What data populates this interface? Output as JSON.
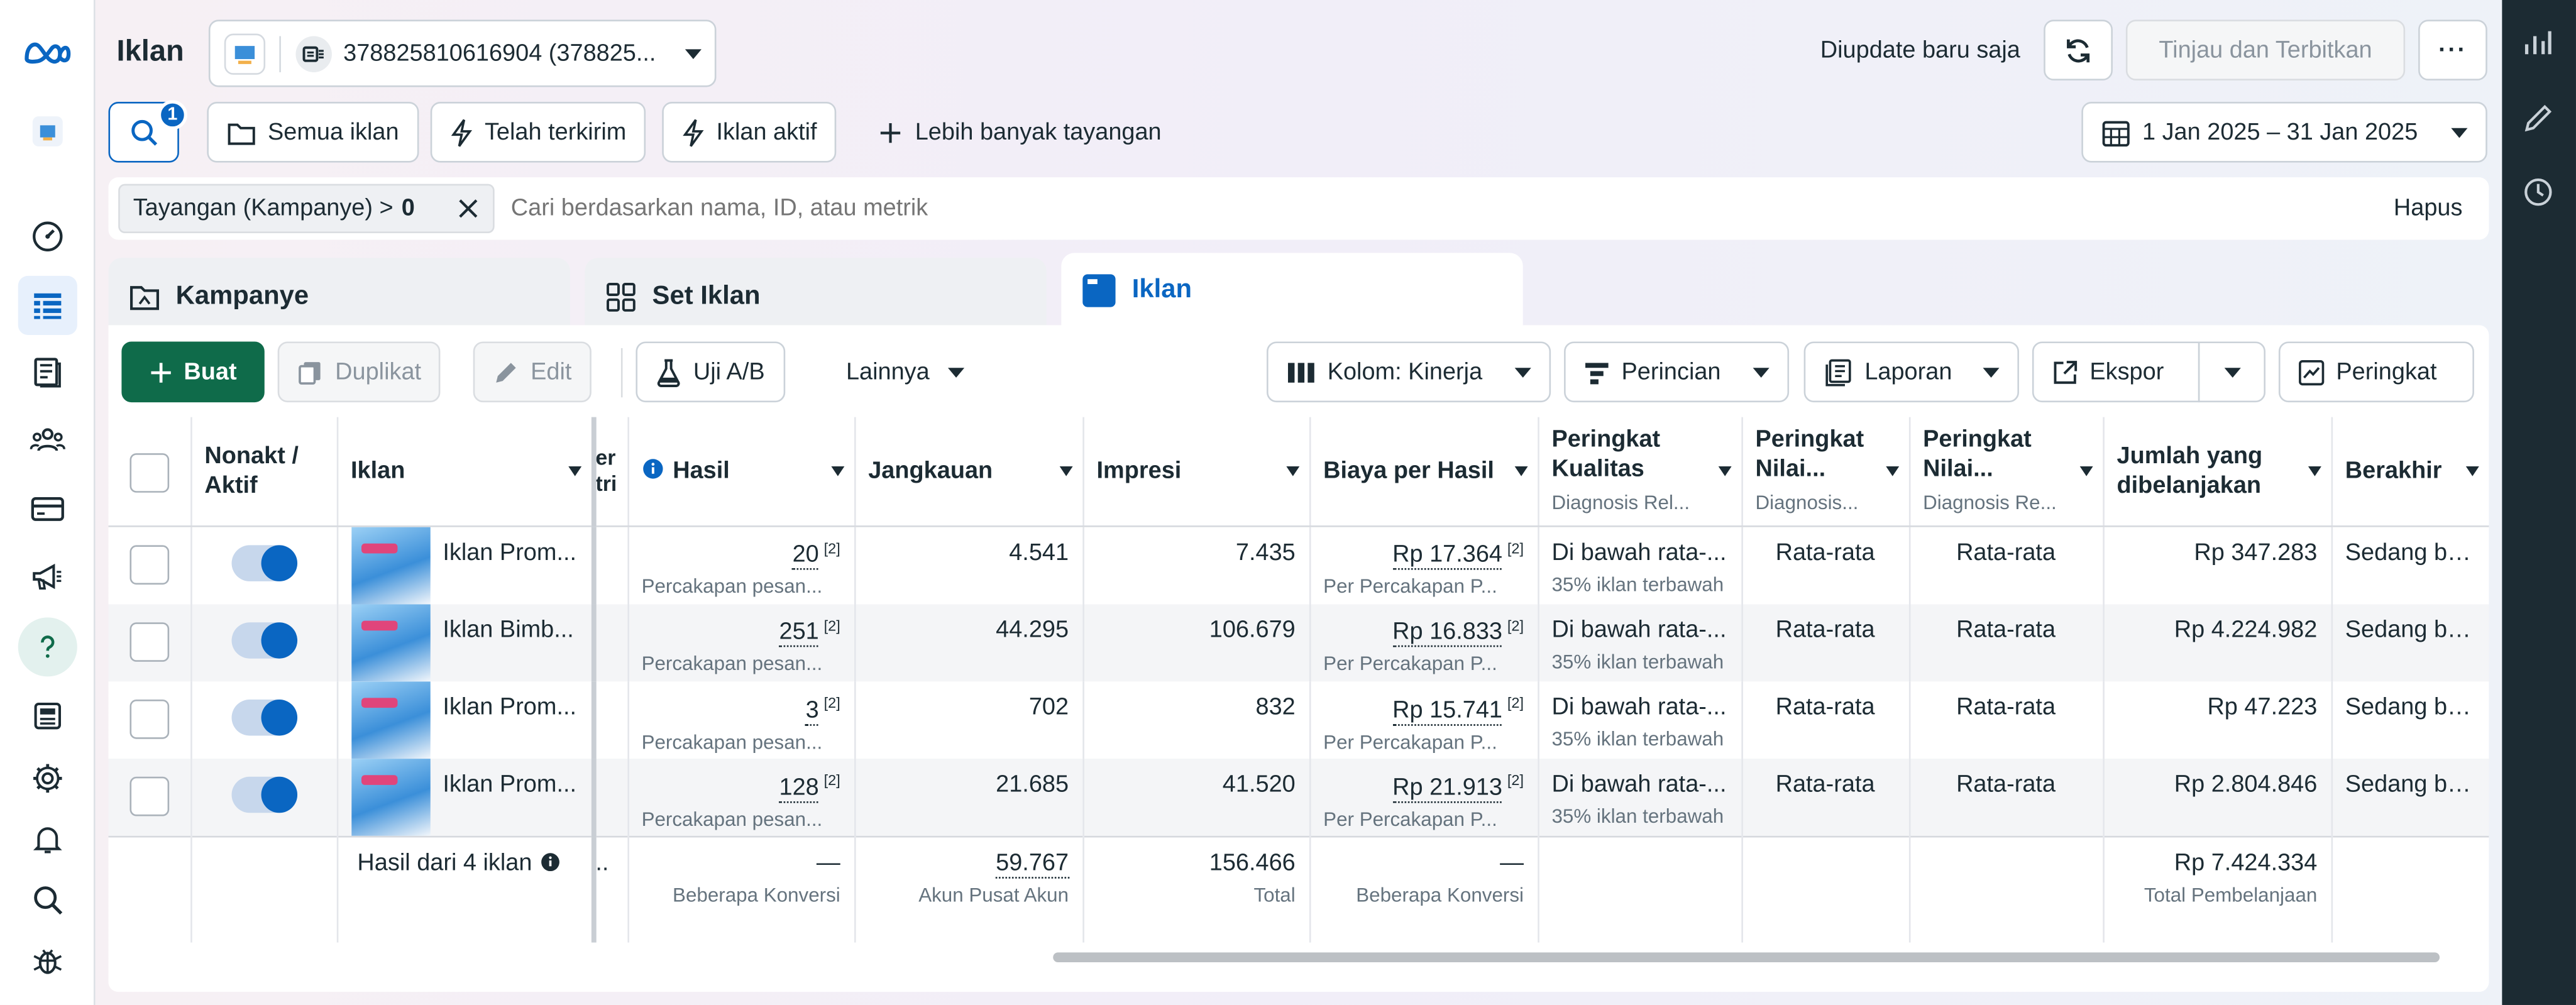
{
  "header": {
    "title": "Iklan",
    "account_name": "378825810616904 (378825...",
    "update_status": "Diupdate baru saja",
    "review_publish": "Tinjau dan Terbitkan",
    "more_label": "···"
  },
  "toolbar": {
    "search_badge": "1",
    "all_ads": "Semua iklan",
    "delivered": "Telah terkirim",
    "active_ads": "Iklan aktif",
    "more_views": "Lebih banyak tayangan",
    "date_range": "1 Jan 2025 – 31 Jan 2025"
  },
  "filter": {
    "chip_label": "Tayangan (Kampanye) >",
    "chip_value": "0",
    "placeholder": "Cari berdasarkan nama, ID, atau metrik",
    "clear": "Hapus"
  },
  "tabs": [
    {
      "label": "Kampanye"
    },
    {
      "label": "Set Iklan"
    },
    {
      "label": "Iklan"
    }
  ],
  "actions": {
    "create": "Buat",
    "duplicate": "Duplikat",
    "edit": "Edit",
    "ab_test": "Uji A/B",
    "more": "Lainnya",
    "columns": "Kolom: Kinerja",
    "breakdown": "Perincian",
    "reports": "Laporan",
    "export": "Ekspor",
    "rank": "Peringkat"
  },
  "table": {
    "headers": {
      "toggle": "Nonakt / Aktif",
      "ad": "Iklan",
      "partial": "er tri",
      "results": "Hasil",
      "reach": "Jangkauan",
      "impressions": "Impresi",
      "cost_per_result": "Biaya per Hasil",
      "quality_rank": "Peringkat Kualitas",
      "quality_rank_sub": "Diagnosis Rel...",
      "engagement_rank": "Peringkat Nilai...",
      "engagement_rank_sub": "Diagnosis...",
      "conversion_rank": "Peringkat Nilai...",
      "conversion_rank_sub": "Diagnosis Re...",
      "amount_spent": "Jumlah yang dibelanjakan",
      "ends": "Berakhir"
    },
    "rows": [
      {
        "name": "Iklan Prom...",
        "results": "20",
        "results_note": "[2]",
        "results_sub": "Percakapan pesan...",
        "reach": "4.541",
        "impressions": "7.435",
        "cpr": "Rp 17.364",
        "cpr_note": "[2]",
        "cpr_sub": "Per Percakapan P...",
        "quality": "Di bawah rata-...",
        "quality_sub": "35% iklan terbawah",
        "engagement": "Rata-rata",
        "conversion": "Rata-rata",
        "spent": "Rp 347.283",
        "ends": "Sedang ber..."
      },
      {
        "name": "Iklan Bimb...",
        "results": "251",
        "results_note": "[2]",
        "results_sub": "Percakapan pesan...",
        "reach": "44.295",
        "impressions": "106.679",
        "cpr": "Rp 16.833",
        "cpr_note": "[2]",
        "cpr_sub": "Per Percakapan P...",
        "quality": "Di bawah rata-...",
        "quality_sub": "35% iklan terbawah",
        "engagement": "Rata-rata",
        "conversion": "Rata-rata",
        "spent": "Rp 4.224.982",
        "ends": "Sedang ber..."
      },
      {
        "name": "Iklan Prom...",
        "results": "3",
        "results_note": "[2]",
        "results_sub": "Percakapan pesan...",
        "reach": "702",
        "impressions": "832",
        "cpr": "Rp 15.741",
        "cpr_note": "[2]",
        "cpr_sub": "Per Percakapan P...",
        "quality": "Di bawah rata-...",
        "quality_sub": "35% iklan terbawah",
        "engagement": "Rata-rata",
        "conversion": "Rata-rata",
        "spent": "Rp 47.223",
        "ends": "Sedang ber..."
      },
      {
        "name": "Iklan Prom...",
        "results": "128",
        "results_note": "[2]",
        "results_sub": "Percakapan pesan...",
        "reach": "21.685",
        "impressions": "41.520",
        "cpr": "Rp 21.913",
        "cpr_note": "[2]",
        "cpr_sub": "Per Percakapan P...",
        "quality": "Di bawah rata-...",
        "quality_sub": "35% iklan terbawah",
        "engagement": "Rata-rata",
        "conversion": "Rata-rata",
        "spent": "Rp 2.804.846",
        "ends": "Sedang ber..."
      }
    ],
    "summary": {
      "label": "Hasil dari 4 iklan",
      "partial": "..",
      "results": "—",
      "results_sub": "Beberapa Konversi",
      "reach": "59.767",
      "reach_sub": "Akun Pusat Akun",
      "impressions": "156.466",
      "impressions_sub": "Total",
      "cpr": "—",
      "cpr_sub": "Beberapa Konversi",
      "spent": "Rp 7.424.334",
      "spent_sub": "Total Pembelanjaan"
    }
  },
  "colors": {
    "brand_blue": "#0a66c2",
    "create_green": "#0f6b4a",
    "right_rail": "#1c2b33"
  }
}
